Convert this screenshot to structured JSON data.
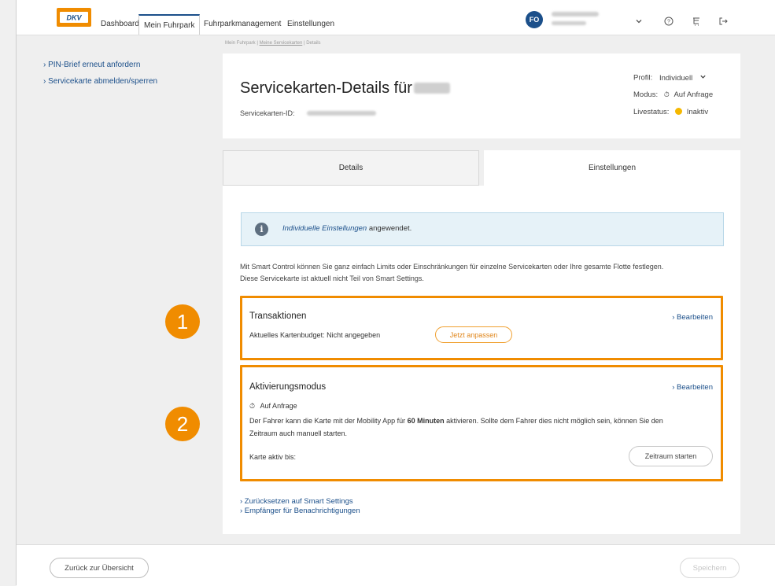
{
  "nav": {
    "logo_text": "DKV",
    "tabs": [
      "Dashboard",
      "Mein Fuhrpark",
      "Fuhrparkmanagement",
      "Einstellungen"
    ],
    "avatar_initials": "FO",
    "icons": [
      "chevron-down-icon",
      "help-icon",
      "cart-icon",
      "logout-icon"
    ]
  },
  "breadcrumb": {
    "item1": "Mein Fuhrpark",
    "item2": "Meine Servicekarten",
    "item3": "Details"
  },
  "sidebar": {
    "links": [
      "› PIN-Brief erneut anfordern",
      "› Servicekarte abmelden/sperren"
    ]
  },
  "header": {
    "title": "Servicekarten-Details für",
    "id_label": "Servicekarten-ID:",
    "profile_label": "Profil:",
    "profile_value": "Individuell",
    "mode_label": "Modus:",
    "mode_value": "Auf Anfrage",
    "live_label": "Livestatus:",
    "live_value": "Inaktiv",
    "live_color": "#f5b800"
  },
  "tabs": {
    "details": "Details",
    "settings": "Einstellungen"
  },
  "info": {
    "link_text": "Individuelle Einstellungen",
    "rest_text": "angewendet."
  },
  "description": {
    "line1": "Mit Smart Control können Sie ganz einfach Limits oder Einschränkungen für einzelne Servicekarten oder Ihre gesamte Flotte festlegen.",
    "line2": "Diese Servicekarte ist aktuell nicht Teil von Smart Settings."
  },
  "transactions": {
    "title": "Transaktionen",
    "edit": "› Bearbeiten",
    "budget_text": "Aktuelles Kartenbudget: Nicht angegeben",
    "adjust_button": "Jetzt anpassen"
  },
  "activation": {
    "title": "Aktivierungsmodus",
    "edit": "› Bearbeiten",
    "mode": "Auf Anfrage",
    "text_part1": "Der Fahrer kann die Karte mit der Mobility App für",
    "text_bold": "60 Minuten",
    "text_part2": "aktivieren. Sollte dem Fahrer dies nicht möglich sein, können Sie den",
    "text_line2": "Zeitraum auch manuell starten.",
    "active_until": "Karte aktiv bis:",
    "start_button": "Zeitraum starten"
  },
  "links": {
    "reset": "› Zurücksetzen auf Smart Settings",
    "recipients": "› Empfänger für Benachrichtigungen"
  },
  "badges": [
    "1",
    "2"
  ],
  "footer": {
    "back_button": "Zurück zur Übersicht",
    "save_button": "Speichern"
  },
  "colors": {
    "brand_blue": "#1b4f8a",
    "highlight_orange": "#f08c00"
  }
}
